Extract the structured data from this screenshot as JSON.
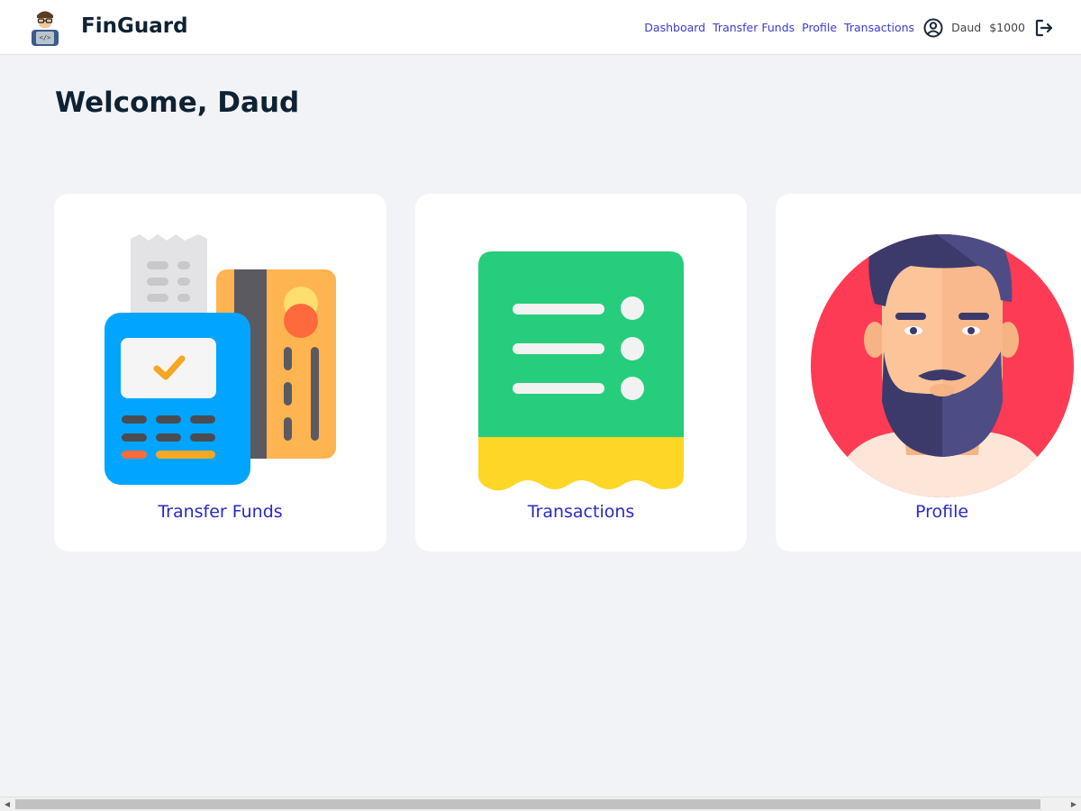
{
  "brand": {
    "name": "FinGuard",
    "logo_icon": "coder-avatar-icon"
  },
  "nav": {
    "links": [
      "Dashboard",
      "Transfer Funds",
      "Profile",
      "Transactions"
    ],
    "user_icon": "user-circle-icon",
    "user_name": "Daud",
    "balance": "$1000",
    "logout_icon": "logout-icon"
  },
  "main": {
    "welcome": "Welcome, Daud",
    "cards": [
      {
        "label": "Transfer Funds",
        "icon": "payment-terminal-icon"
      },
      {
        "label": "Transactions",
        "icon": "receipt-list-icon"
      },
      {
        "label": "Profile",
        "icon": "bearded-man-avatar-icon"
      }
    ]
  },
  "colors": {
    "brand_dark": "#0f2233",
    "link_blue": "#3b3bd8",
    "card_label_blue": "#2929c8",
    "background": "#f2f3f6"
  }
}
